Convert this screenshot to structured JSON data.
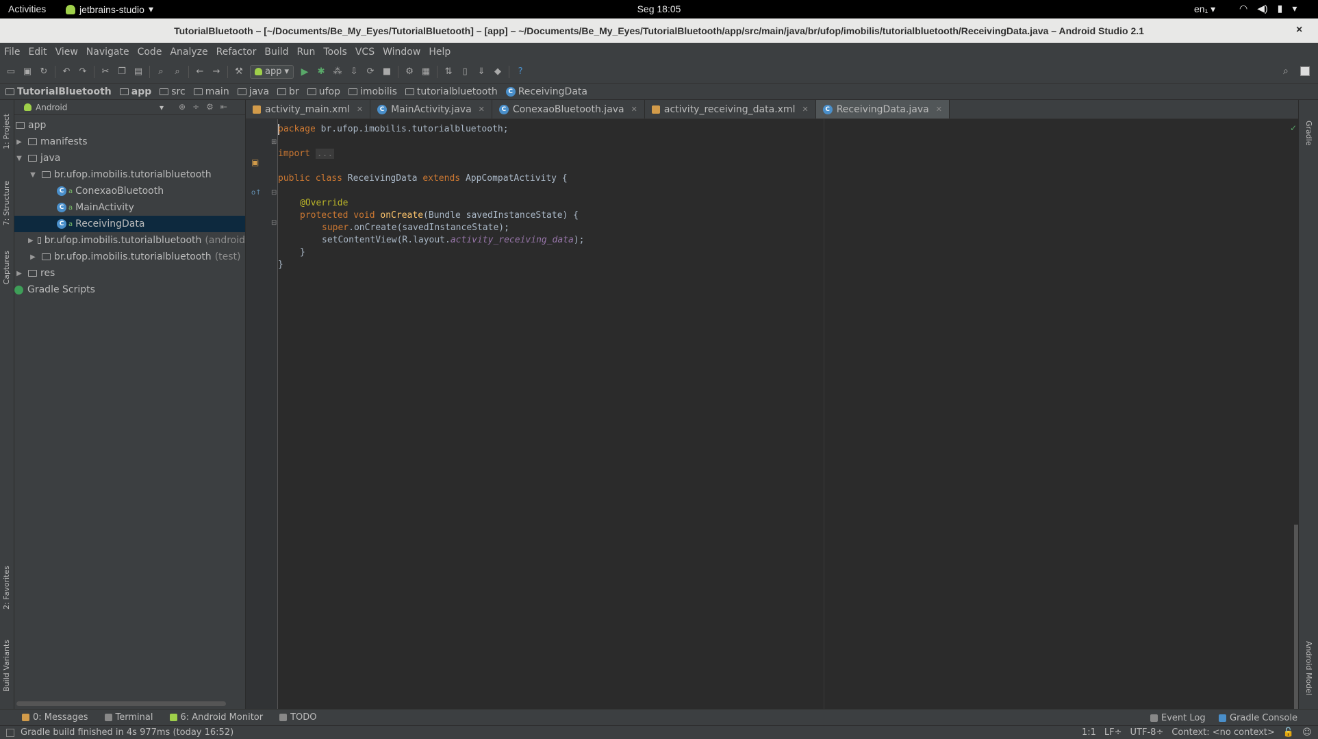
{
  "topbar": {
    "activities": "Activities",
    "app_name": "jetbrains-studio",
    "clock": "Seg 18:05",
    "lang": "en₁"
  },
  "window": {
    "title": "TutorialBluetooth – [~/Documents/Be_My_Eyes/TutorialBluetooth] – [app] – ~/Documents/Be_My_Eyes/TutorialBluetooth/app/src/main/java/br/ufop/imobilis/tutorialbluetooth/ReceivingData.java – Android Studio 2.1",
    "close": "×"
  },
  "menu": [
    "File",
    "Edit",
    "View",
    "Navigate",
    "Code",
    "Analyze",
    "Refactor",
    "Build",
    "Run",
    "Tools",
    "VCS",
    "Window",
    "Help"
  ],
  "toolbar": {
    "run_config": "app",
    "help": "?"
  },
  "breadcrumb": [
    "TutorialBluetooth",
    "app",
    "src",
    "main",
    "java",
    "br",
    "ufop",
    "imobilis",
    "tutorialbluetooth",
    "ReceivingData"
  ],
  "side_tools": {
    "project": "1: Project",
    "structure": "7: Structure",
    "captures": "Captures",
    "favorites": "2: Favorites",
    "build_variants": "Build Variants",
    "gradle": "Gradle",
    "android_model": "Android Model"
  },
  "project_panel": {
    "view": "Android",
    "tree": [
      {
        "label": "app",
        "suffix": ""
      },
      {
        "label": "manifests",
        "suffix": ""
      },
      {
        "label": "java",
        "suffix": ""
      },
      {
        "label": "br.ufop.imobilis.tutorialbluetooth",
        "suffix": ""
      },
      {
        "label": "ConexaoBluetooth",
        "suffix": ""
      },
      {
        "label": "MainActivity",
        "suffix": ""
      },
      {
        "label": "ReceivingData",
        "suffix": ""
      },
      {
        "label": "br.ufop.imobilis.tutorialbluetooth",
        "suffix": "(android"
      },
      {
        "label": "br.ufop.imobilis.tutorialbluetooth",
        "suffix": "(test)"
      },
      {
        "label": "res",
        "suffix": ""
      },
      {
        "label": "Gradle Scripts",
        "suffix": ""
      }
    ]
  },
  "tabs": [
    "activity_main.xml",
    "MainActivity.java",
    "ConexaoBluetooth.java",
    "activity_receiving_data.xml",
    "ReceivingData.java"
  ],
  "code": {
    "l1_kw": "package",
    "l1_rest": " br.ufop.imobilis.tutorialbluetooth;",
    "l2_kw": "import",
    "l2_fold": "...",
    "l3_kw": "public class",
    "l3_name": " ReceivingData ",
    "l3_kw2": "extends",
    "l3_rest": " AppCompatActivity {",
    "l4_ann": "@Override",
    "l5_kw": "protected void",
    "l5_fn": "onCreate",
    "l5_rest": "(Bundle savedInstanceState) {",
    "l6_kw": "super",
    "l6_rest": ".onCreate(savedInstanceState);",
    "l7_a": "setContentView(R.layout.",
    "l7_it": "activity_receiving_data",
    "l7_b": ");",
    "l8": "}",
    "l9": "}"
  },
  "bottom_tools": {
    "messages": "0: Messages",
    "terminal": "Terminal",
    "monitor": "6: Android Monitor",
    "todo": "TODO",
    "event_log": "Event Log",
    "gradle_console": "Gradle Console"
  },
  "status": {
    "message": "Gradle build finished in 4s 977ms (today 16:52)",
    "position": "1:1",
    "line_sep": "LF÷",
    "encoding": "UTF-8÷",
    "context": "Context: <no context>"
  }
}
